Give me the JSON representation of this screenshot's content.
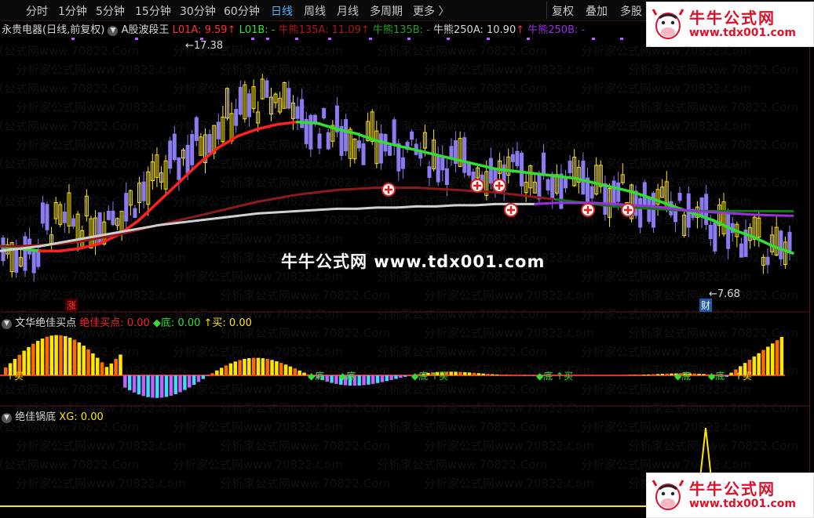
{
  "toolbar": {
    "timeframes": [
      "分时",
      "1分钟",
      "5分钟",
      "15分钟",
      "30分钟",
      "60分钟",
      "日线",
      "周线",
      "月线",
      "多周期",
      "更多 〉"
    ],
    "active": "日线",
    "fuquan": "复权",
    "diejia": "叠加",
    "duogu": "多股"
  },
  "logo": {
    "cn": "牛牛公式网",
    "url": "www.tdx001.com"
  },
  "main_panel": {
    "stock": "永贵电器(日线,前复权)",
    "indicator": "A股波段王",
    "l01a_label": "L01A: ",
    "l01a_value": "9.59",
    "l01b_label": "L01B: ",
    "l01b_value": "-",
    "nx135a_label": "牛熊135A: ",
    "nx135a_value": "11.09",
    "nx135b_label": "牛熊135B: ",
    "nx135b_value": "-",
    "nx250a_label": "牛熊250A: ",
    "nx250a_value": "10.90",
    "nx250b_label": "牛熊250B: ",
    "nx250b_value": "-",
    "high_label": "17.38",
    "low_label": "7.68",
    "zhang_badge": "涨",
    "cai_badge": "财"
  },
  "watermark": "牛牛公式网 www.tdx001.com",
  "bg_watermark": "分析家公式网www.70822.Com",
  "panel2": {
    "name": "文华绝佳买点",
    "buy_label": "绝佳买点: ",
    "buy_value": "0.00",
    "di_label": "◆底: ",
    "di_value": "0.00",
    "mai_label": "↑买: ",
    "mai_value": "0.00",
    "marker_mai": "↑买",
    "marker_di": "◆底",
    "marker_di2": "◆底",
    "marker_di_mai": "◆底 ↑买"
  },
  "panel3": {
    "name": "绝佳锅底",
    "xg_label": "XG: ",
    "xg_value": "0.00"
  },
  "colors": {
    "up": "#ffe600",
    "down": "#8a7cf0",
    "red_line": "#ff2020",
    "green_line": "#30e030",
    "dark_red": "#8b1a1a",
    "dark_green": "#107a10",
    "white_line": "#d0d0d0",
    "purple_line": "#9a2ee0",
    "orange": "#ff6a00",
    "cyan": "#40d8f8",
    "magenta": "#c060ff"
  },
  "chart_data": {
    "type": "line",
    "title": "A股波段王",
    "high": 17.38,
    "low": 7.68,
    "ylim": [
      7.0,
      18.5
    ],
    "series": [
      {
        "name": "L01A",
        "values": [
          9.6,
          9.5,
          9.4,
          9.4,
          9.5,
          9.7,
          10.1,
          10.7,
          11.5,
          12.3,
          13.1,
          13.8,
          14.3,
          14.6,
          14.8,
          14.9,
          14.85,
          14.6,
          14.4,
          14.1,
          13.9,
          13.7,
          13.5,
          13.3,
          13.1,
          12.9,
          12.8,
          12.7,
          12.6,
          12.5,
          12.3,
          12.1,
          11.9,
          11.6,
          11.3,
          11.0,
          10.7,
          10.3,
          10.0,
          9.6,
          9.3
        ]
      },
      {
        "name": "牛熊135A",
        "values": [
          9.6,
          9.6,
          9.65,
          9.7,
          9.8,
          9.95,
          10.1,
          10.3,
          10.5,
          10.7,
          10.9,
          11.1,
          11.3,
          11.5,
          11.65,
          11.8,
          11.9,
          12.0,
          12.05,
          12.1,
          12.1,
          12.1,
          12.05,
          12.0,
          11.95,
          11.9,
          11.8,
          11.7,
          11.6,
          11.5,
          11.4,
          11.3,
          11.25,
          11.2,
          11.15,
          11.1,
          11.1,
          11.1,
          11.1,
          11.1,
          11.09
        ]
      },
      {
        "name": "牛熊250A",
        "values": [
          9.4,
          9.5,
          9.6,
          9.75,
          9.9,
          10.05,
          10.2,
          10.35,
          10.5,
          10.6,
          10.7,
          10.8,
          10.9,
          11.0,
          11.05,
          11.1,
          11.15,
          11.2,
          11.2,
          11.25,
          11.25,
          11.3,
          11.3,
          11.35,
          11.35,
          11.4,
          11.4,
          11.4,
          11.45,
          11.45,
          11.45,
          11.4,
          11.35,
          11.3,
          11.2,
          11.1,
          11.05,
          11.0,
          10.95,
          10.92,
          10.9
        ]
      }
    ]
  }
}
